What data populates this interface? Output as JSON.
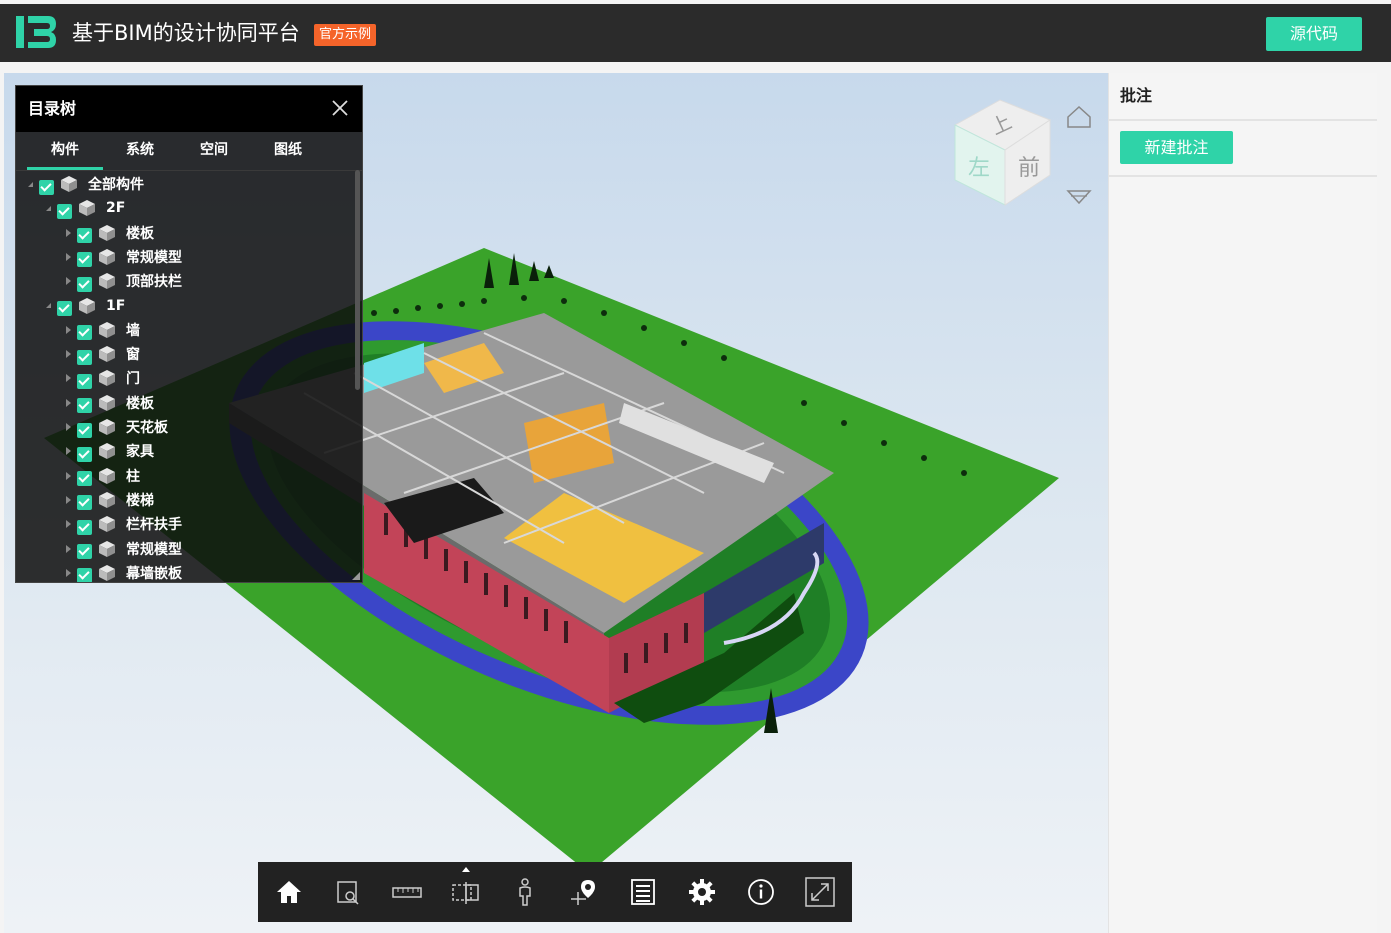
{
  "header": {
    "title": "基于BIM的设计协同平台",
    "badge": "官方示例",
    "source_button": "源代码"
  },
  "tree_panel": {
    "title": "目录树",
    "tabs": [
      "构件",
      "系统",
      "空间",
      "图纸"
    ],
    "active_tab": 0,
    "rows": [
      {
        "label": "全部构件",
        "level": 0,
        "expanded": true
      },
      {
        "label": "2F",
        "level": 1,
        "expanded": true
      },
      {
        "label": "楼板",
        "level": 2,
        "expanded": false
      },
      {
        "label": "常规模型",
        "level": 2,
        "expanded": false
      },
      {
        "label": "顶部扶栏",
        "level": 2,
        "expanded": false
      },
      {
        "label": "1F",
        "level": 1,
        "expanded": true
      },
      {
        "label": "墙",
        "level": 2,
        "expanded": false
      },
      {
        "label": "窗",
        "level": 2,
        "expanded": false
      },
      {
        "label": "门",
        "level": 2,
        "expanded": false
      },
      {
        "label": "楼板",
        "level": 2,
        "expanded": false
      },
      {
        "label": "天花板",
        "level": 2,
        "expanded": false
      },
      {
        "label": "家具",
        "level": 2,
        "expanded": false
      },
      {
        "label": "柱",
        "level": 2,
        "expanded": false
      },
      {
        "label": "楼梯",
        "level": 2,
        "expanded": false
      },
      {
        "label": "栏杆扶手",
        "level": 2,
        "expanded": false
      },
      {
        "label": "常规模型",
        "level": 2,
        "expanded": false
      },
      {
        "label": "幕墙嵌板",
        "level": 2,
        "expanded": false
      }
    ]
  },
  "viewcube": {
    "top": "上",
    "front": "前",
    "left": "左"
  },
  "toolbar": {
    "tools": [
      {
        "name": "home-icon"
      },
      {
        "name": "zoom-window-icon"
      },
      {
        "name": "measure-ruler-icon"
      },
      {
        "name": "section-box-icon"
      },
      {
        "name": "walk-person-icon"
      },
      {
        "name": "location-pin-icon"
      },
      {
        "name": "properties-list-icon"
      },
      {
        "name": "settings-gear-icon"
      },
      {
        "name": "info-icon"
      },
      {
        "name": "fullscreen-icon"
      }
    ]
  },
  "annotation_panel": {
    "title": "批注",
    "new_button": "新建批注"
  },
  "colors": {
    "accent": "#2fd3a8",
    "badge": "#f5642a",
    "topbar": "#2b2b2b"
  }
}
